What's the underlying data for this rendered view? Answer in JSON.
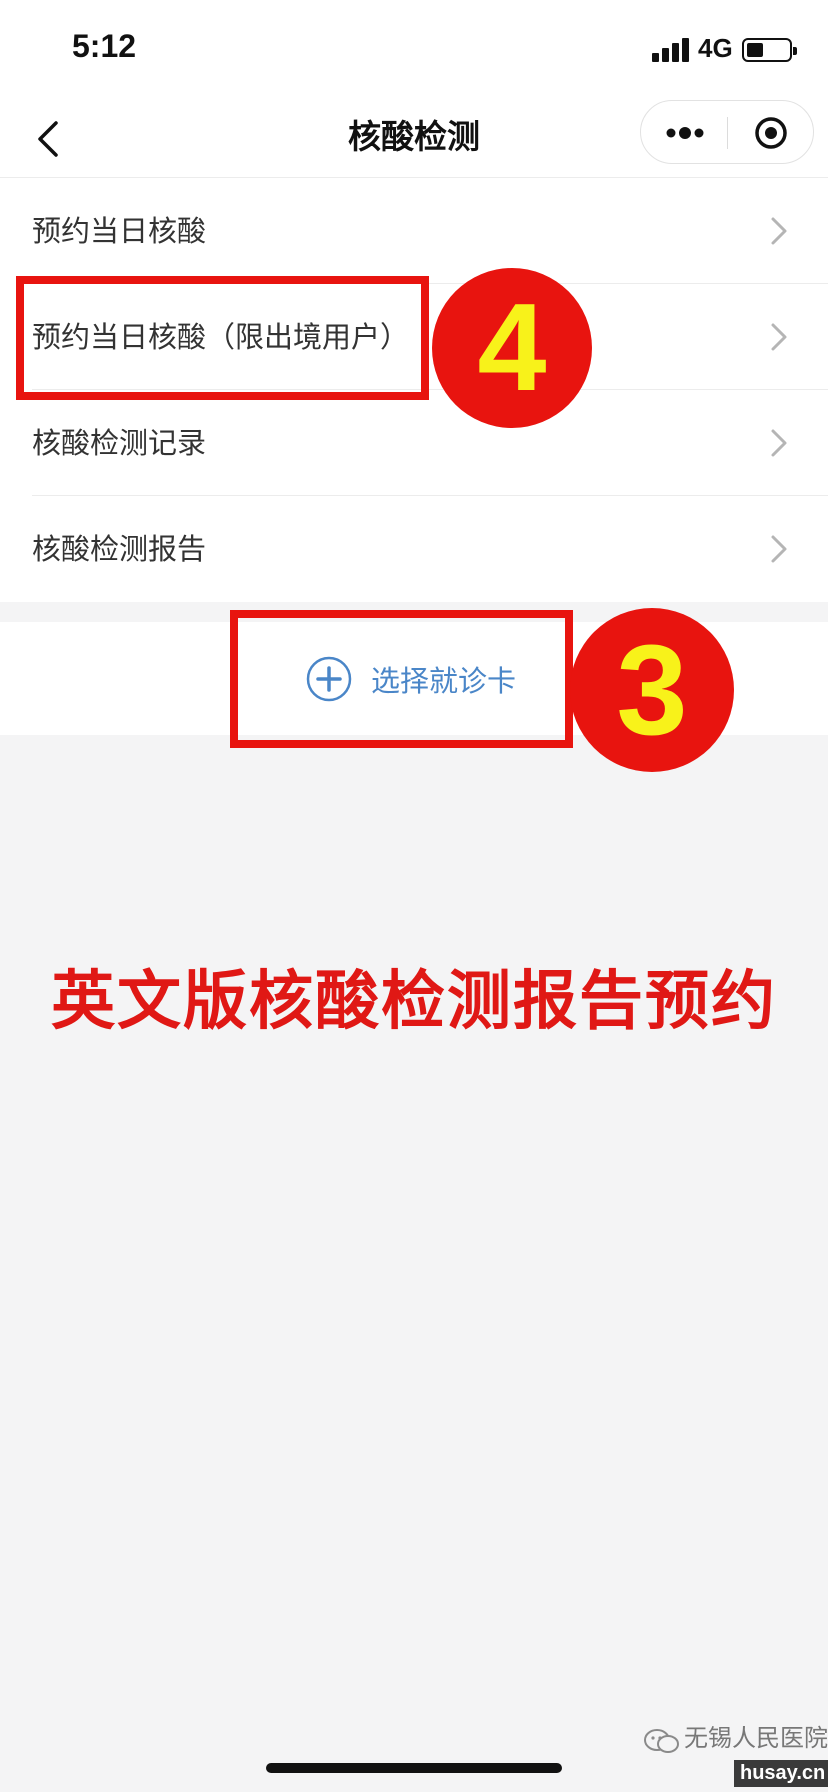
{
  "status_bar": {
    "time": "5:12",
    "network": "4G"
  },
  "nav": {
    "title": "核酸检测"
  },
  "menu": {
    "items": [
      {
        "label": "预约当日核酸"
      },
      {
        "label": "预约当日核酸（限出境用户）"
      },
      {
        "label": "核酸检测记录"
      },
      {
        "label": "核酸检测报告"
      }
    ]
  },
  "card": {
    "label": "选择就诊卡"
  },
  "annotations": {
    "badge_4": "4",
    "badge_3": "3",
    "caption": "英文版核酸检测报告预约",
    "accent_color": "#e8140f",
    "number_color": "#f8f21a"
  },
  "watermark": {
    "text": "无锡人民医院",
    "domain": "husay.cn"
  }
}
